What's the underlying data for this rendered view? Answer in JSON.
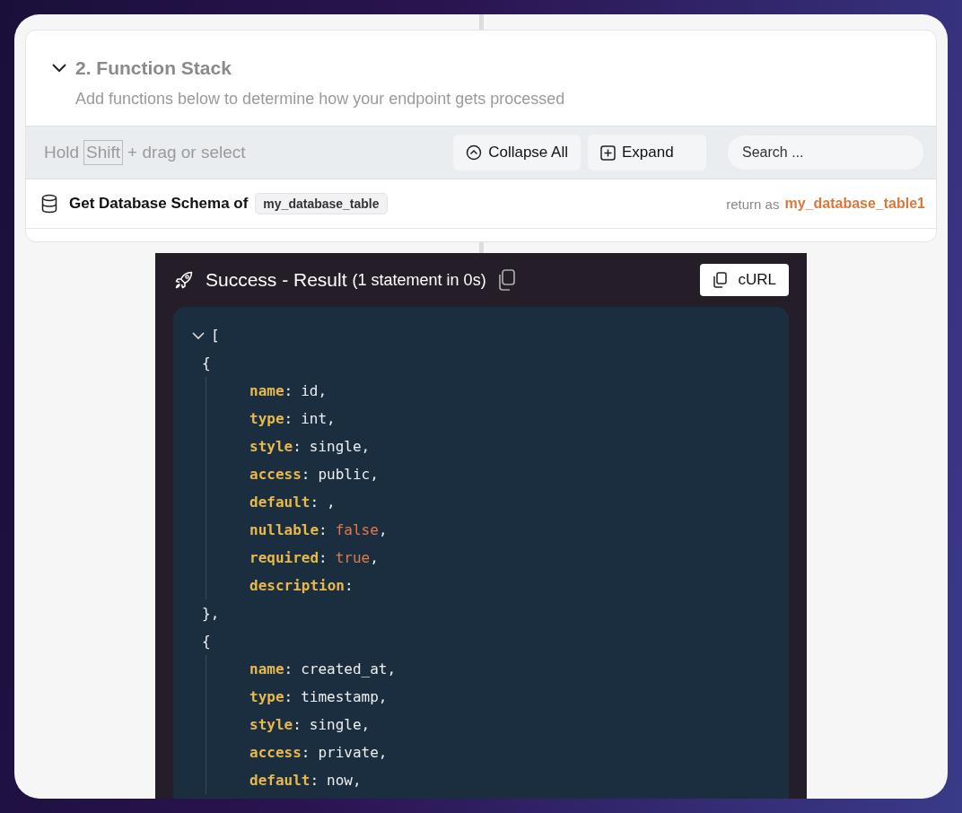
{
  "section": {
    "expanded": true,
    "title": "2. Function Stack",
    "subtitle": "Add functions below to determine how your endpoint gets processed"
  },
  "toolbar": {
    "hint_before": "Hold",
    "key": "Shift",
    "hint_after": "+ drag or select",
    "buttons": [
      {
        "label": "Collapse All",
        "kind": "collapse"
      },
      {
        "label": "Expand",
        "kind": "expand"
      }
    ],
    "search": {
      "placeholder": "Search ..."
    }
  },
  "functions": [
    {
      "title": "Get Database Schema of",
      "table": "my_database_table",
      "return_label": "return as",
      "return_var": "my_database_table1"
    }
  ],
  "result": {
    "title": "Success - Result",
    "detail": "(1 statement in 0s)",
    "curl_label": "cURL",
    "expanded": true,
    "open_bracket": "[",
    "items": [
      {
        "open": "{",
        "fields": [
          {
            "key": "name",
            "sep": ":",
            "value": "id,",
            "kind": "text"
          },
          {
            "key": "type",
            "sep": ":",
            "value": "int,",
            "kind": "text"
          },
          {
            "key": "style",
            "sep": ":",
            "value": "single,",
            "kind": "text"
          },
          {
            "key": "access",
            "sep": ":",
            "value": "public,",
            "kind": "text"
          },
          {
            "key": "default",
            "sep": ":",
            "value": ",",
            "kind": "text"
          },
          {
            "key": "nullable",
            "sep": ":",
            "value": "false",
            "trailing": ",",
            "kind": "literal"
          },
          {
            "key": "required",
            "sep": ":",
            "value": "true",
            "trailing": ",",
            "kind": "literal"
          },
          {
            "key": "description",
            "sep": ":",
            "kind": "empty"
          }
        ],
        "close": "},"
      },
      {
        "open": "{",
        "fields": [
          {
            "key": "name",
            "sep": ":",
            "value": "created_at,",
            "kind": "text"
          },
          {
            "key": "type",
            "sep": ":",
            "value": "timestamp,",
            "kind": "text"
          },
          {
            "key": "style",
            "sep": ":",
            "value": "single,",
            "kind": "text"
          },
          {
            "key": "access",
            "sep": ":",
            "value": "private,",
            "kind": "text"
          },
          {
            "key": "default",
            "sep": ":",
            "value": "now,",
            "kind": "text"
          }
        ]
      }
    ]
  }
}
